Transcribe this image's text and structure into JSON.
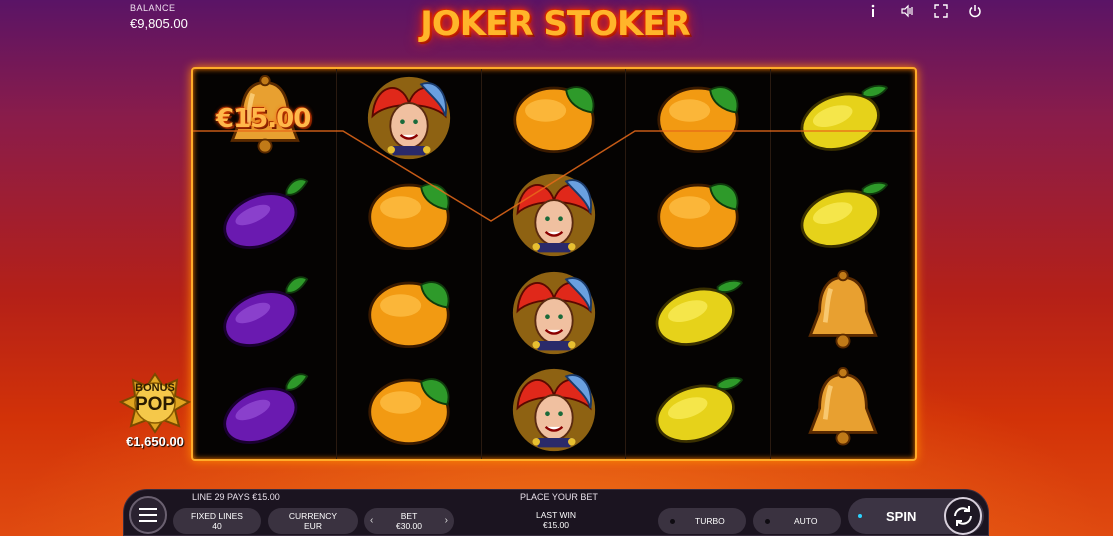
{
  "header": {
    "balance_label": "BALANCE",
    "balance_value": "€9,805.00",
    "game_title": "JOKER STOKER",
    "icons": [
      "info-icon",
      "sound-icon",
      "fullscreen-icon",
      "power-icon"
    ]
  },
  "reels": [
    [
      "bell",
      "plum",
      "plum",
      "plum"
    ],
    [
      "joker",
      "orange",
      "orange",
      "orange"
    ],
    [
      "orange",
      "joker",
      "joker",
      "joker"
    ],
    [
      "orange",
      "orange",
      "lemon",
      "lemon"
    ],
    [
      "lemon",
      "lemon",
      "bell",
      "bell"
    ]
  ],
  "win_amount": "€15.00",
  "bonus_pop": {
    "line1": "BONUS",
    "line2": "POP",
    "amount": "€1,650.00"
  },
  "controls": {
    "line_info": "LINE 29 PAYS €15.00",
    "status": "PLACE YOUR BET",
    "fixed_lines_label": "FIXED LINES",
    "fixed_lines_value": "40",
    "currency_label": "CURRENCY",
    "currency_value": "EUR",
    "bet_label": "BET",
    "bet_value": "€30.00",
    "bet_decrease": "‹",
    "bet_increase": "›",
    "last_win_label": "LAST WIN",
    "last_win_value": "€15.00",
    "turbo_label": "TURBO",
    "auto_label": "AUTO",
    "spin_label": "SPIN"
  },
  "colors": {
    "frame_glow": "#ffab2a",
    "bar_bg": "#1b1420",
    "pill_bg": "#3a3240"
  }
}
